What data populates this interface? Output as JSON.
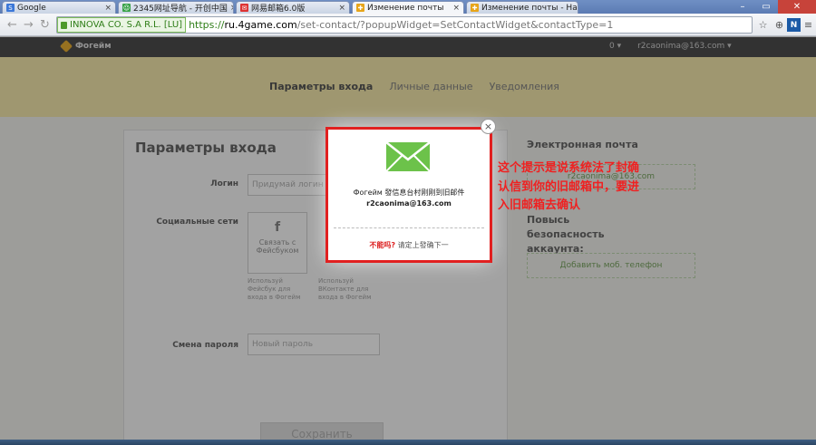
{
  "browser": {
    "tabs": [
      {
        "label": "Google",
        "active": false,
        "favicon": "google-icon",
        "color": "#3c78d8"
      },
      {
        "label": "2345网址导航 - 开创中国",
        "active": false,
        "favicon": "nav-icon",
        "color": "#3aa34a"
      },
      {
        "label": "网易邮箱6.0版",
        "active": false,
        "favicon": "mail-icon",
        "color": "#d33"
      },
      {
        "label": "Изменение почты",
        "active": true,
        "favicon": "4game-icon",
        "color": "#e7a51a"
      },
      {
        "label": "Изменение почты - На",
        "active": false,
        "favicon": "4game-icon",
        "color": "#e7a51a"
      }
    ],
    "ev_certificate": "INNOVA CO. S.A R.L. [LU]",
    "url_proto": "https://",
    "url_host": "ru.4game.com",
    "url_rest": "/set-contact/?popupWidget=SetContactWidget&contactType=1"
  },
  "site": {
    "brand": "Фогейм",
    "balance": "0 ▾",
    "user": "r2caonima@163.com ▾",
    "tabs": [
      "Параметры входа",
      "Личные данные",
      "Уведомления"
    ],
    "card_title": "Параметры входа",
    "login_label": "Логин",
    "login_placeholder": "Придумай логин",
    "social_label": "Социальные сети",
    "social_fb_icon": "f",
    "social_fb_text": "Связать с Фейсбуком",
    "social_note_1": "Используй Фейсбук для входа в Фогейм",
    "social_note_2": "Используй ВКонтакте для входа в Фогейм",
    "password_label": "Смена пароля",
    "password_placeholder": "Новый пароль",
    "save_label": "Сохранить",
    "email_heading": "Электронная почта",
    "email_value": "r2caonima@163.com",
    "security_heading": "Повысь безопасность аккаунта:",
    "add_phone": "Добавить моб. телефон"
  },
  "popup": {
    "message": "Фогейм 發信息台村刚刚到旧邮件",
    "email": "r2caonima@163.com",
    "link_red": "不能吗?",
    "link_text": "请定上發确下一",
    "close_label": "×",
    "icon": "envelope-icon",
    "accent": "#6cc24a"
  },
  "annotation": {
    "text": "这个提示是说系统法了封确认信到你的旧邮箱中，要进入旧邮箱去确认",
    "color": "#f02020"
  }
}
